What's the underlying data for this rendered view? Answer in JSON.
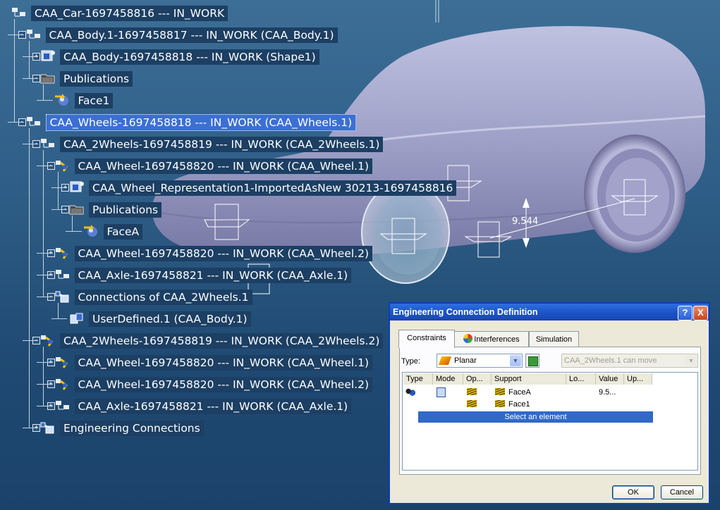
{
  "tree": [
    {
      "label": "CAA_Car-1697458816 --- IN_WORK",
      "icon": "product-icon",
      "toggle": ""
    },
    {
      "label": "CAA_Body.1-1697458817 --- IN_WORK (CAA_Body.1)",
      "icon": "product-icon",
      "toggle": "-"
    },
    {
      "label": "CAA_Body-1697458818 --- IN_WORK (Shape1)",
      "icon": "part-shape-icon",
      "toggle": "+"
    },
    {
      "label": "Publications",
      "icon": "publications-folder-icon",
      "toggle": "-"
    },
    {
      "label": "Face1",
      "icon": "face-publication-icon",
      "toggle": ""
    },
    {
      "label": "CAA_Wheels-1697458818 --- IN_WORK (CAA_Wheels.1)",
      "icon": "product-icon",
      "toggle": "-",
      "selected": true
    },
    {
      "label": "CAA_2Wheels-1697458819 --- IN_WORK (CAA_2Wheels.1)",
      "icon": "product-icon",
      "toggle": "-"
    },
    {
      "label": "CAA_Wheel-1697458820 --- IN_WORK (CAA_Wheel.1)",
      "icon": "flexible-product-icon",
      "toggle": "-"
    },
    {
      "label": "CAA_Wheel_Representation1-ImportedAsNew 30213-1697458816",
      "icon": "part-shape-icon",
      "toggle": "+"
    },
    {
      "label": "Publications",
      "icon": "publications-folder-icon",
      "toggle": "-"
    },
    {
      "label": "FaceA",
      "icon": "face-publication-icon",
      "toggle": ""
    },
    {
      "label": "CAA_Wheel-1697458820 --- IN_WORK (CAA_Wheel.2)",
      "icon": "flexible-product-icon",
      "toggle": "+"
    },
    {
      "label": "CAA_Axle-1697458821 --- IN_WORK (CAA_Axle.1)",
      "icon": "product-icon",
      "toggle": "+"
    },
    {
      "label": "Connections of CAA_2Wheels.1",
      "icon": "connections-icon",
      "toggle": "-"
    },
    {
      "label": "UserDefined.1 (CAA_Body.1)",
      "icon": "connection-icon",
      "toggle": ""
    },
    {
      "label": "CAA_2Wheels-1697458819 --- IN_WORK (CAA_2Wheels.2)",
      "icon": "flexible-product-icon",
      "toggle": "-"
    },
    {
      "label": "CAA_Wheel-1697458820 --- IN_WORK (CAA_Wheel.1)",
      "icon": "flexible-product-icon",
      "toggle": "+"
    },
    {
      "label": "CAA_Wheel-1697458820 --- IN_WORK (CAA_Wheel.2)",
      "icon": "flexible-product-icon",
      "toggle": "+"
    },
    {
      "label": "CAA_Axle-1697458821 --- IN_WORK (CAA_Axle.1)",
      "icon": "product-icon",
      "toggle": "+"
    },
    {
      "label": "Engineering Connections",
      "icon": "connections-icon",
      "toggle": "+"
    }
  ],
  "viewport": {
    "dimension_value": "9.544"
  },
  "dialog": {
    "title": "Engineering Connection Definition",
    "help_label": "?",
    "close_label": "X",
    "tabs": [
      {
        "label": "Constraints"
      },
      {
        "label": "Interferences"
      },
      {
        "label": "Simulation"
      }
    ],
    "type_label": "Type:",
    "type_value": "Planar",
    "mobility_value": "CAA_2Wheels.1 can move",
    "columns": [
      "Type",
      "Mode",
      "Op...",
      "Support",
      "Lo...",
      "Value",
      "Up..."
    ],
    "rows": [
      {
        "support": "FaceA",
        "value": "9.5..."
      },
      {
        "support": "Face1",
        "value": ""
      }
    ],
    "prompt_row": "Select an element",
    "ok_label": "OK",
    "cancel_label": "Cancel"
  },
  "colors": {
    "tree_label_bg": "#1c3f63",
    "selection": "#3b6fd3",
    "dialog_title": "#1d55c8"
  }
}
